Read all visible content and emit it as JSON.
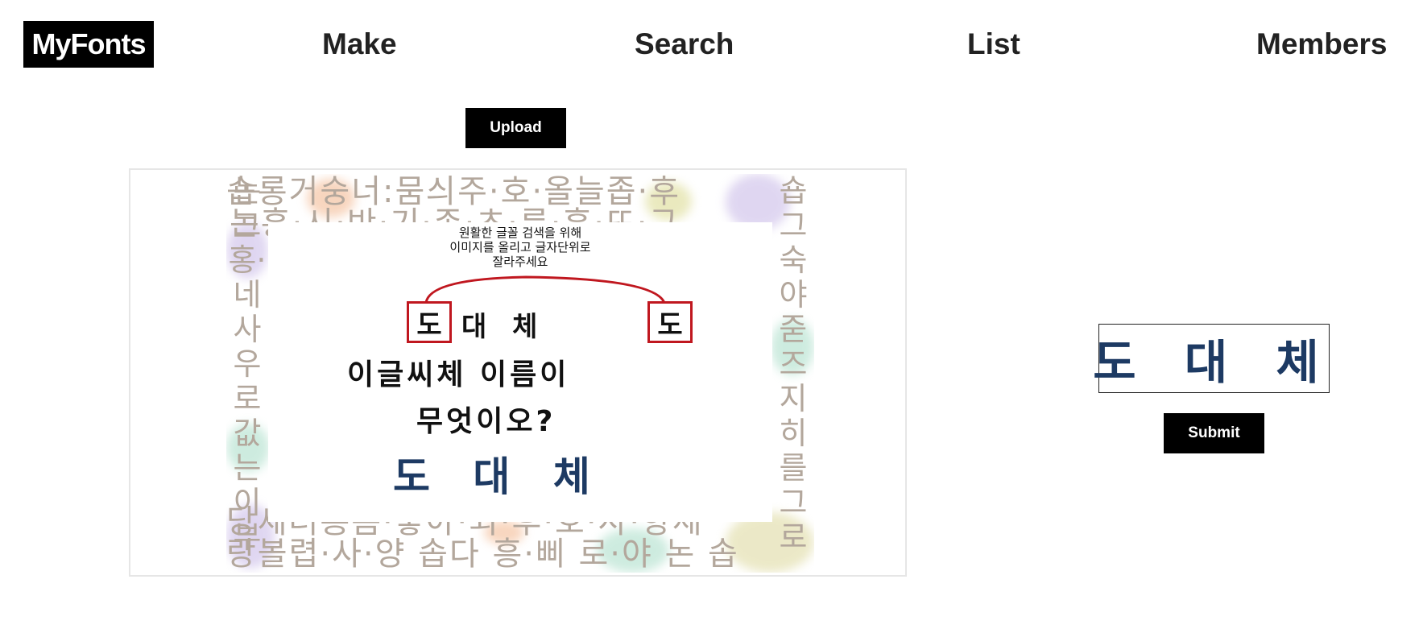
{
  "nav": {
    "logo": "MyFonts",
    "items": [
      "Make",
      "Search",
      "List",
      "Members"
    ]
  },
  "upload": {
    "label": "Upload"
  },
  "submit": {
    "label": "Submit"
  },
  "uploaded_image": {
    "instruction_lines": [
      "원활한 글꼴 검색을 위해",
      "이미지를 올리고 글자단위로",
      "잘라주세요"
    ],
    "highlight_char": "도",
    "line1_rest": "대 체",
    "line2": "이글씨체 이름이",
    "line3": "무엇이오?",
    "font_name": "도 대 체",
    "bg_rows": {
      "top1": "숍롱거숭너:뭄싀주·호·올늘좁·후",
      "top2": "논흥·시·반·기·존·초·름·흥·뜨·구",
      "bottom1": "당세러릉름·놓아·외·후·호·사·항세",
      "bottom2": "랑볼렵·사·양 솝다 흥·삐 로·야 논 솝"
    },
    "bg_cols": {
      "left": "논그홍·네사우로값는이부",
      "right": "숍그숙야줃즈지히를그로"
    }
  },
  "crop_preview": {
    "text": "도 대 체"
  },
  "colors": {
    "accent": "#000000",
    "highlight_red": "#c0171f",
    "font_blue": "#1d3a63",
    "bg_glyph": "#b3a79c"
  }
}
